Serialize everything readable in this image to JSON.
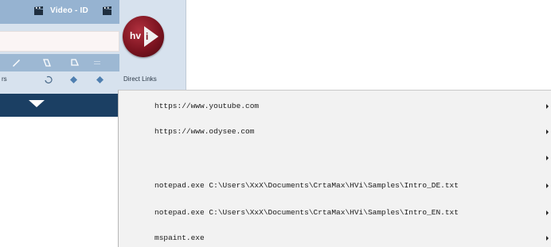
{
  "header": {
    "title": "Video - ID"
  },
  "toolbar": {
    "left_label": "rs",
    "direct_links_label": "Direct Links"
  },
  "logo": {
    "text": "hv",
    "letter": "i"
  },
  "menu": {
    "items": [
      {
        "label": "https://www.youtube.com"
      },
      {
        "label": "https://www.odysee.com"
      },
      {
        "label": ""
      },
      {
        "label": "notepad.exe C:\\Users\\XxX\\Documents\\CrtaMax\\HVi\\Samples\\Intro_DE.txt"
      },
      {
        "label": "notepad.exe C:\\Users\\XxX\\Documents\\CrtaMax\\HVi\\Samples\\Intro_EN.txt"
      },
      {
        "label": "mspaint.exe"
      }
    ]
  },
  "colors": {
    "accent_dark_blue": "#1b3f63",
    "panel": "#d7e2ee",
    "logo_red": "#7c1420"
  }
}
